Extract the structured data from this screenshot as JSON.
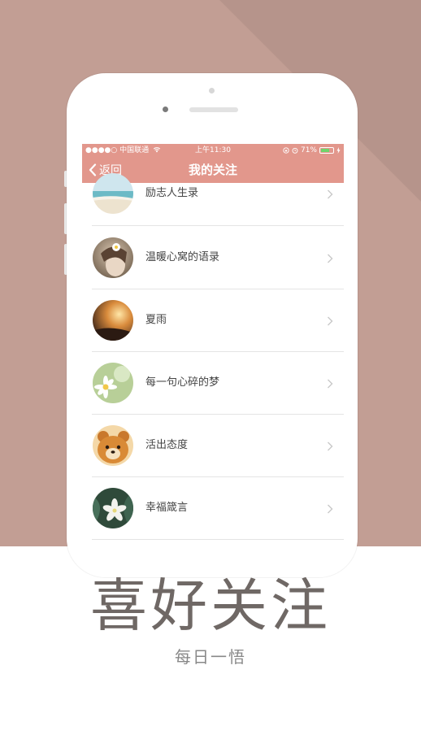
{
  "status_bar": {
    "carrier": "●●●●○ 中国联通",
    "time": "上午11:30",
    "battery": "71%",
    "battery_level": 0.71
  },
  "nav": {
    "back_label": "返回",
    "title": "我的关注"
  },
  "list_items": [
    {
      "label": "励志人生录",
      "avatar": "beach-photo"
    },
    {
      "label": "温暖心窝的语录",
      "avatar": "girl-with-flower-photo"
    },
    {
      "label": "夏雨",
      "avatar": "sunset-photo"
    },
    {
      "label": "每一句心碎的梦",
      "avatar": "daisy-photo"
    },
    {
      "label": "活出态度",
      "avatar": "teddy-bear-photo"
    },
    {
      "label": "幸福箴言",
      "avatar": "white-flower-photo"
    }
  ],
  "footer": {
    "headline": "喜好关注",
    "subline": "每日一悟"
  },
  "colors": {
    "background": "#c29e94",
    "accent": "#e2978c",
    "headline": "#6f6865"
  }
}
